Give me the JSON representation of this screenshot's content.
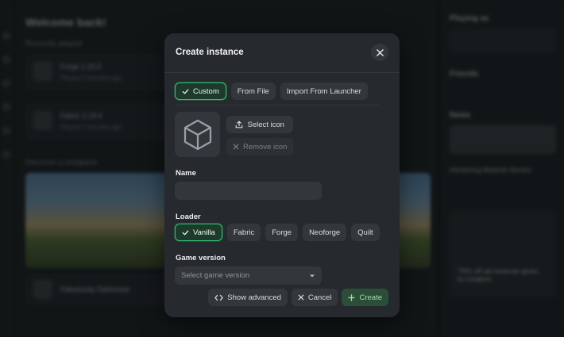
{
  "background": {
    "title": "Welcome back!",
    "recently_played": "Recently played",
    "recent_cards": [
      {
        "name": "Forge 1.19.4",
        "sub": "Played 3 minutes ago"
      },
      {
        "name": "Fabric 1.19.4",
        "sub": "Played 3 minutes ago"
      }
    ],
    "discover": "Discover a modpack",
    "bottom_card": "Fabulously Optimized",
    "right": {
      "playing_as": "Playing as",
      "friends": "Friends",
      "news": "News",
      "news_text": "Introducing Modrinth Servers",
      "promo": "75% off ad revenue given to creators"
    }
  },
  "modal": {
    "title": "Create instance",
    "close_icon": "close-icon",
    "source_tabs": [
      {
        "label": "Custom",
        "active": true
      },
      {
        "label": "From File",
        "active": false
      },
      {
        "label": "Import From Launcher",
        "active": false
      }
    ],
    "select_icon_label": "Select icon",
    "remove_icon_label": "Remove icon",
    "name_label": "Name",
    "name_value": "",
    "loader_label": "Loader",
    "loaders": [
      {
        "label": "Vanilla",
        "active": true
      },
      {
        "label": "Fabric",
        "active": false
      },
      {
        "label": "Forge",
        "active": false
      },
      {
        "label": "Neoforge",
        "active": false
      },
      {
        "label": "Quilt",
        "active": false
      }
    ],
    "game_version_label": "Game version",
    "game_version_placeholder": "Select game version",
    "show_advanced_label": "Show advanced",
    "cancel_label": "Cancel",
    "create_label": "Create"
  },
  "colors": {
    "accent": "#2fbf6d",
    "modal_bg": "#26292d",
    "button_bg": "#33373c"
  }
}
